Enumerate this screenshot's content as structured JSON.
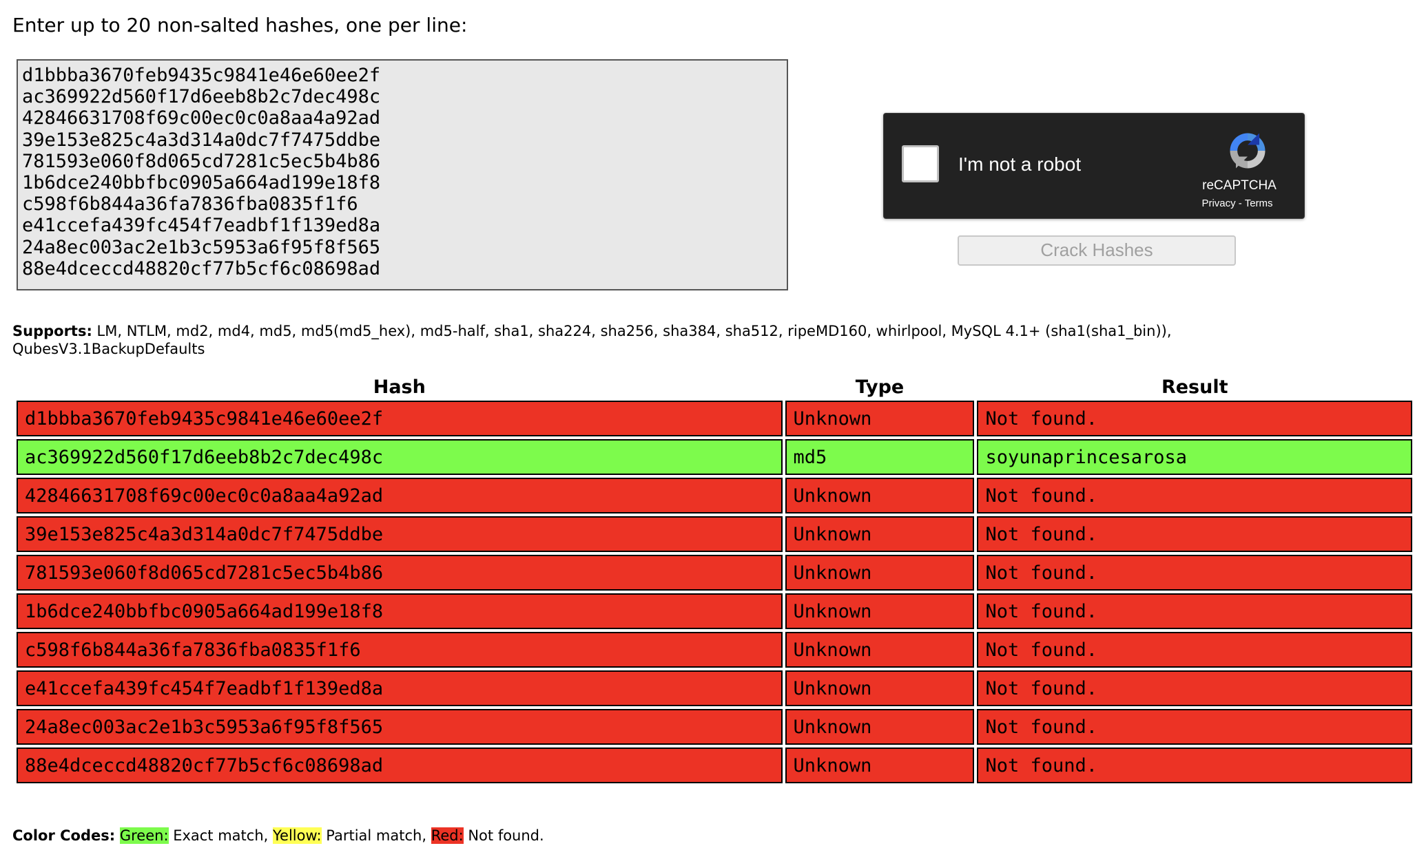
{
  "prompt": "Enter up to 20 non-salted hashes, one per line:",
  "input": {
    "value": "d1bbba3670feb9435c9841e46e60ee2f\nac369922d560f17d6eeb8b2c7dec498c\n42846631708f69c00ec0c0a8aa4a92ad\n39e153e825c4a3d314a0dc7f7475ddbe\n781593e060f8d065cd7281c5ec5b4b86\n1b6dce240bbfbc0905a664ad199e18f8\nc598f6b844a36fa7836fba0835f1f6\ne41ccefa439fc454f7eadbf1f139ed8a\n24a8ec003ac2e1b3c5953a6f95f8f565\n88e4dceccd48820cf77b5cf6c08698ad"
  },
  "captcha": {
    "label": "I'm not a robot",
    "brand": "reCAPTCHA",
    "privacy": "Privacy",
    "separator": " - ",
    "terms": "Terms"
  },
  "crack_button": "Crack Hashes",
  "supports": {
    "label": "Supports:",
    "text": " LM, NTLM, md2, md4, md5, md5(md5_hex), md5-half, sha1, sha224, sha256, sha384, sha512, ripeMD160, whirlpool, MySQL 4.1+ (sha1(sha1_bin)), QubesV3.1BackupDefaults"
  },
  "table": {
    "headers": {
      "hash": "Hash",
      "type": "Type",
      "result": "Result"
    },
    "rows": [
      {
        "hash": "d1bbba3670feb9435c9841e46e60ee2f",
        "type": "Unknown",
        "result": "Not found.",
        "status": "red"
      },
      {
        "hash": "ac369922d560f17d6eeb8b2c7dec498c",
        "type": "md5",
        "result": "soyunaprincesarosa",
        "status": "green"
      },
      {
        "hash": "42846631708f69c00ec0c0a8aa4a92ad",
        "type": "Unknown",
        "result": "Not found.",
        "status": "red"
      },
      {
        "hash": "39e153e825c4a3d314a0dc7f7475ddbe",
        "type": "Unknown",
        "result": "Not found.",
        "status": "red"
      },
      {
        "hash": "781593e060f8d065cd7281c5ec5b4b86",
        "type": "Unknown",
        "result": "Not found.",
        "status": "red"
      },
      {
        "hash": "1b6dce240bbfbc0905a664ad199e18f8",
        "type": "Unknown",
        "result": "Not found.",
        "status": "red"
      },
      {
        "hash": "c598f6b844a36fa7836fba0835f1f6",
        "type": "Unknown",
        "result": "Not found.",
        "status": "red"
      },
      {
        "hash": "e41ccefa439fc454f7eadbf1f139ed8a",
        "type": "Unknown",
        "result": "Not found.",
        "status": "red"
      },
      {
        "hash": "24a8ec003ac2e1b3c5953a6f95f8f565",
        "type": "Unknown",
        "result": "Not found.",
        "status": "red"
      },
      {
        "hash": "88e4dceccd48820cf77b5cf6c08698ad",
        "type": "Unknown",
        "result": "Not found.",
        "status": "red"
      }
    ]
  },
  "color_codes": {
    "label": "Color Codes:",
    "green": "Green:",
    "green_desc": " Exact match, ",
    "yellow": "Yellow:",
    "yellow_desc": " Partial match, ",
    "red": "Red:",
    "red_desc": " Not found."
  },
  "colors": {
    "red": "#ec3325",
    "green": "#7dfb4c",
    "yellow": "#ffff55",
    "captcha_bg": "#222222"
  }
}
